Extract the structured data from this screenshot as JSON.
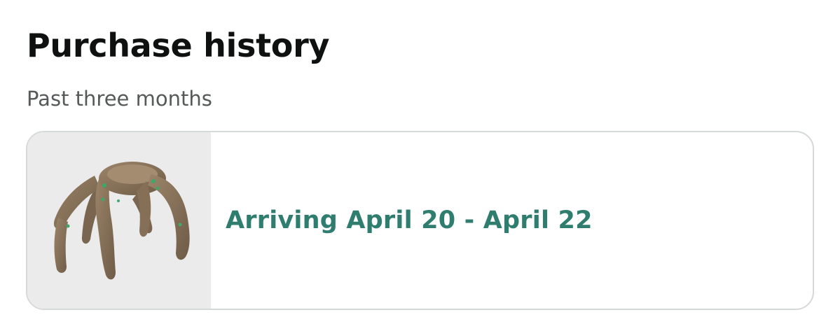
{
  "header": {
    "title": "Purchase history",
    "subtitle": "Past three months"
  },
  "orders": [
    {
      "delivery_status": "Arriving April 20 - April 22",
      "status_color": "#2f7d6f",
      "image_icon": "product-figure-image"
    }
  ]
}
